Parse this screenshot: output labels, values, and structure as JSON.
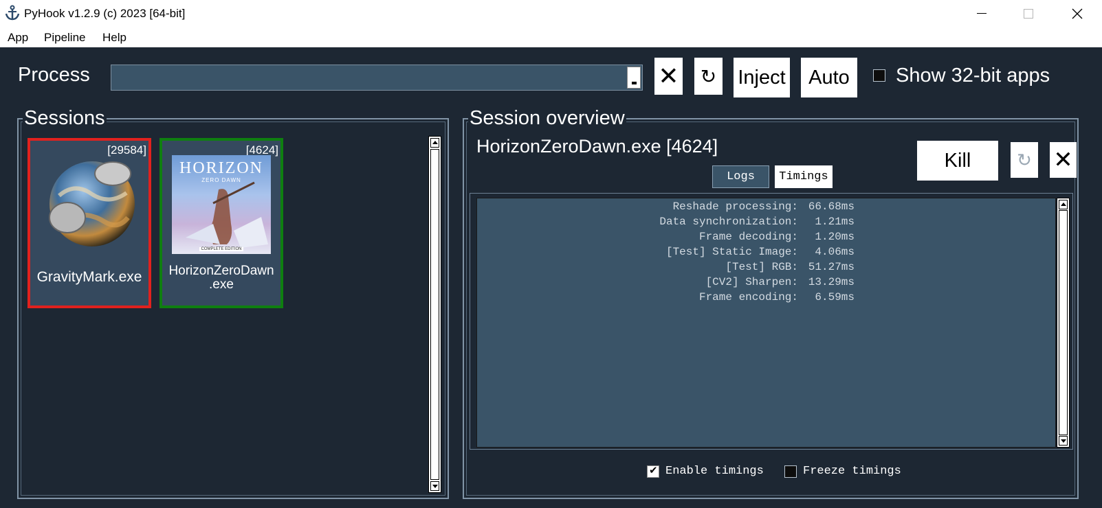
{
  "window": {
    "title": "PyHook v1.2.9 (c) 2023 [64-bit]",
    "controls": {
      "minimize": "—",
      "close": "✕"
    }
  },
  "menu": [
    "App",
    "Pipeline",
    "Help"
  ],
  "process": {
    "label": "Process",
    "selected_value": "",
    "clear_label": "✕",
    "refresh_label": "↻",
    "inject_label": "Inject",
    "auto_label": "Auto",
    "show32_label": "Show 32-bit apps",
    "show32_checked": false
  },
  "sessions": {
    "title": "Sessions",
    "items": [
      {
        "name": "GravityMark.exe",
        "pid": "[29584]",
        "status_color": "#e0211e"
      },
      {
        "name": "HorizonZeroDawn\n.exe",
        "pid": "[4624]",
        "status_color": "#0f7f10",
        "cover": {
          "title": "HORIZON",
          "subtitle": "ZERO DAWN",
          "edition": "COMPLETE EDITION"
        }
      }
    ]
  },
  "overview": {
    "title": "Session overview",
    "session_title": "HorizonZeroDawn.exe [4624]",
    "kill_label": "Kill",
    "refresh_label": "↻",
    "close_label": "✕",
    "tabs": [
      {
        "label": "Logs",
        "active": false
      },
      {
        "label": "Timings",
        "active": true
      }
    ],
    "timings": [
      {
        "name": "Reshade processing:",
        "value": "66.68ms"
      },
      {
        "name": "Data synchronization:",
        "value": "1.21ms"
      },
      {
        "name": "Frame decoding:",
        "value": "1.20ms"
      },
      {
        "name": "[Test] Static Image:",
        "value": "4.06ms"
      },
      {
        "name": "[Test] RGB:",
        "value": "51.27ms"
      },
      {
        "name": "[CV2] Sharpen:",
        "value": "13.29ms"
      },
      {
        "name": "Frame encoding:",
        "value": "6.59ms"
      }
    ],
    "enable_timings_label": "Enable timings",
    "enable_timings_checked": true,
    "freeze_timings_label": "Freeze timings",
    "freeze_timings_checked": false
  },
  "colors": {
    "background": "#1d2733",
    "panel": "#35495e",
    "field": "#3a5468",
    "error_border": "#e0211e",
    "ok_border": "#0f7f10"
  }
}
